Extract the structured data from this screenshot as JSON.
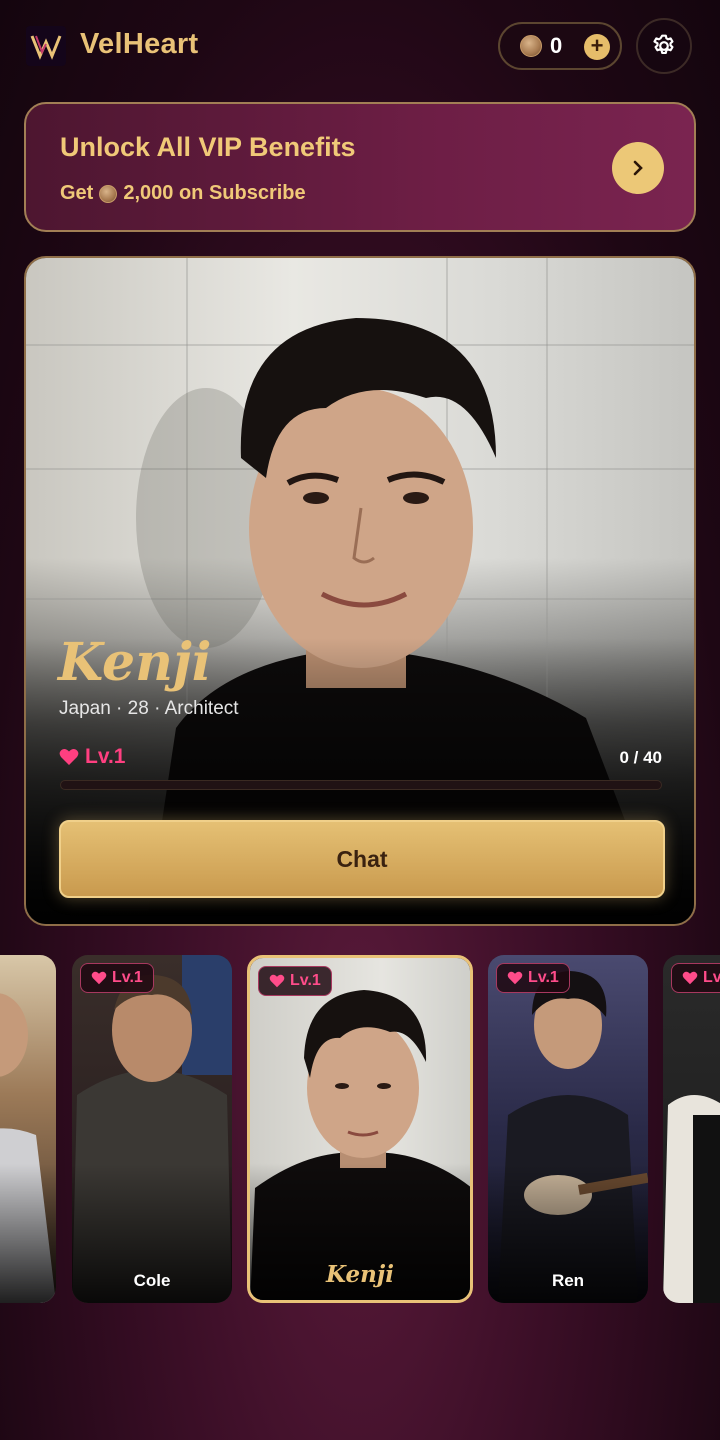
{
  "header": {
    "app_name": "VelHeart",
    "logo_letters": "VW",
    "coins": "0",
    "add_coins_symbol": "+"
  },
  "vip_banner": {
    "title": "Unlock All VIP Benefits",
    "subtitle_prefix": "Get",
    "subtitle_amount": "2,000 on Subscribe"
  },
  "featured": {
    "name": "Kenji",
    "meta": "Japan · 28 · Architect",
    "level": "Lv.1",
    "progress_text": "0 / 40",
    "progress_fraction": 0,
    "chat_label": "Chat"
  },
  "carousel": {
    "items": [
      {
        "name": "",
        "level": ""
      },
      {
        "name": "Cole",
        "level": "Lv.1"
      },
      {
        "name": "Kenji",
        "level": "Lv.1",
        "selected": true
      },
      {
        "name": "Ren",
        "level": "Lv.1"
      },
      {
        "name": "",
        "level": "Lv"
      }
    ]
  },
  "colors": {
    "gold": "#e9c277",
    "pink": "#ff3f80",
    "background": "#3a0e26"
  },
  "icons": [
    "app-logo-icon",
    "coin-icon",
    "plus-icon",
    "gear-icon",
    "chevron-right-icon",
    "heart-icon"
  ]
}
